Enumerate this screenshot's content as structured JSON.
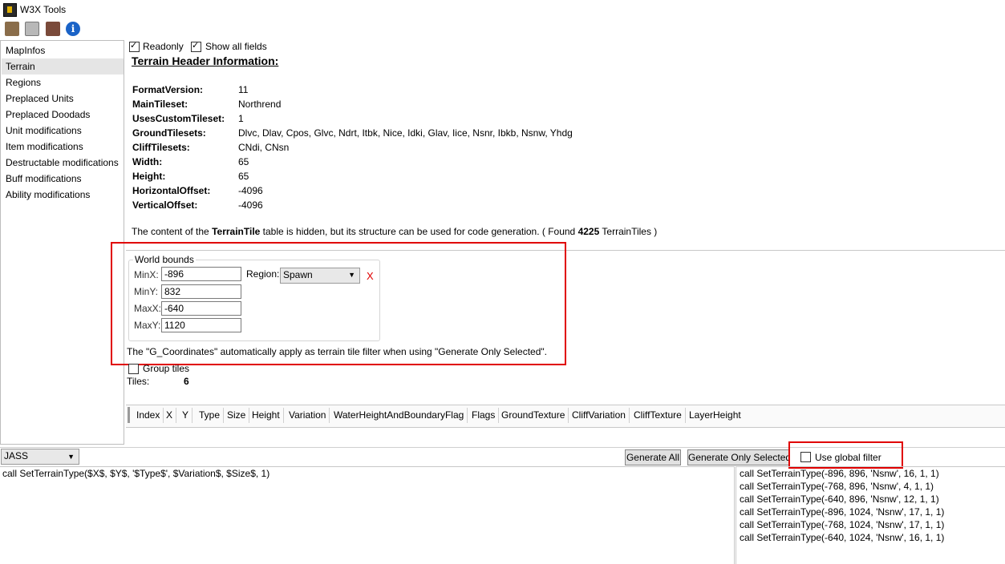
{
  "window": {
    "title": "W3X Tools"
  },
  "toolbar": {
    "icons": [
      "open-map-icon",
      "save-icon",
      "export-icon",
      "info-icon"
    ]
  },
  "sidebar": {
    "items": [
      {
        "label": "MapInfos"
      },
      {
        "label": "Terrain",
        "selected": true
      },
      {
        "label": "Regions"
      },
      {
        "label": "Preplaced Units"
      },
      {
        "label": "Preplaced Doodads"
      },
      {
        "label": "Unit modifications"
      },
      {
        "label": "Item modifications"
      },
      {
        "label": "Destructable modifications"
      },
      {
        "label": "Buff modifications"
      },
      {
        "label": "Ability modifications"
      }
    ]
  },
  "options": {
    "readonly_label": "Readonly",
    "readonly": true,
    "show_all_label": "Show all fields",
    "show_all": true
  },
  "header": {
    "title": "Terrain Header Information:",
    "fields": [
      {
        "name": "FormatVersion:",
        "value": "11"
      },
      {
        "name": "MainTileset:",
        "value": "Northrend"
      },
      {
        "name": "UsesCustomTileset:",
        "value": "1"
      },
      {
        "name": "GroundTilesets:",
        "value": "Dlvc, Dlav, Cpos, Glvc, Ndrt, Itbk, Nice, Idki, Glav, Iice, Nsnr, Ibkb, Nsnw, Yhdg"
      },
      {
        "name": "CliffTilesets:",
        "value": "CNdi, CNsn"
      },
      {
        "name": "Width:",
        "value": "65"
      },
      {
        "name": "Height:",
        "value": "65"
      },
      {
        "name": "HorizontalOffset:",
        "value": "-4096"
      },
      {
        "name": "VerticalOffset:",
        "value": "-4096"
      }
    ]
  },
  "note": {
    "part1": "The content of the ",
    "table": "TerrainTile",
    "part2": " table is hidden, but its structure can be used for code generation. ( Found ",
    "count": "4225",
    "part3": " TerrainTiles )"
  },
  "world_bounds": {
    "title": "World bounds",
    "minx_label": "MinX:",
    "minx": "-896",
    "miny_label": "MinY:",
    "miny": "832",
    "maxx_label": "MaxX:",
    "maxx": "-640",
    "maxy_label": "MaxY:",
    "maxy": "1120",
    "region_label": "Region:",
    "region": "Spawn",
    "clear": "X",
    "hint": "The \"G_Coordinates\" automatically apply as terrain tile filter when using \"Generate Only Selected\"."
  },
  "tiles": {
    "group_label": "Group tiles",
    "count_label": "Tiles:",
    "count": "6"
  },
  "table": {
    "columns": [
      "Index",
      "X",
      "Y",
      "Type",
      "Size",
      "Height",
      "Variation",
      "WaterHeightAndBoundaryFlag",
      "Flags",
      "GroundTexture",
      "CliffVariation",
      "CliffTexture",
      "LayerHeight"
    ]
  },
  "codegen": {
    "language": "JASS",
    "generate_all": "Generate All",
    "generate_selected": "Generate Only Selected",
    "global_filter_label": "Use global filter",
    "global_filter": false,
    "template": "call SetTerrainType($X$, $Y$, '$Type$', $Variation$, $Size$, 1)",
    "output": [
      "call SetTerrainType(-896, 896, 'Nsnw', 16, 1, 1)",
      "call SetTerrainType(-768, 896, 'Nsnw', 4, 1, 1)",
      "call SetTerrainType(-640, 896, 'Nsnw', 12, 1, 1)",
      "call SetTerrainType(-896, 1024, 'Nsnw', 17, 1, 1)",
      "call SetTerrainType(-768, 1024, 'Nsnw', 17, 1, 1)",
      "call SetTerrainType(-640, 1024, 'Nsnw', 16, 1, 1)"
    ]
  },
  "colors": {
    "highlight": "#e00000",
    "selected": "#e5e5e5"
  }
}
